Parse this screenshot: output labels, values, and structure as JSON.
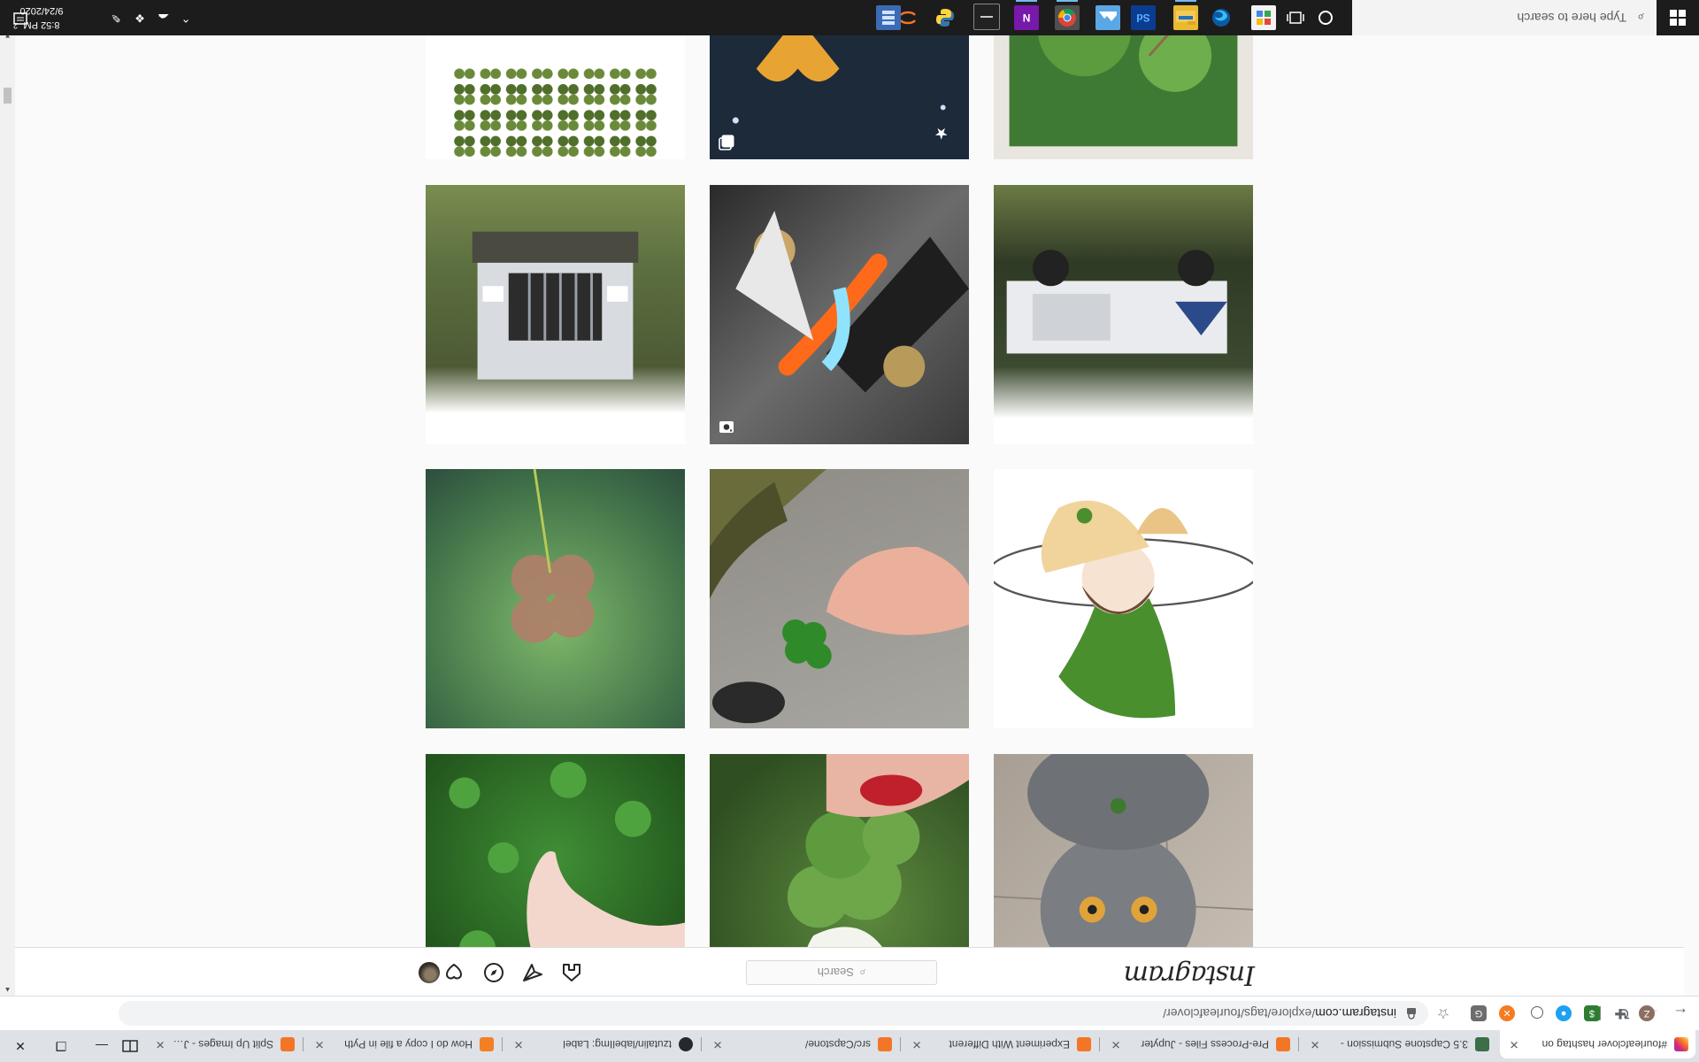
{
  "browser": {
    "tabs": [
      {
        "title": "#fourleafclover hashtag on",
        "favicon_color": "#d6249f",
        "active": true
      },
      {
        "title": "3.5 Capstone Submission - ",
        "favicon_color": "#3c6e47",
        "active": false
      },
      {
        "title": "Pre-Process Files - Jupyter",
        "favicon_color": "#f37626",
        "active": false
      },
      {
        "title": "Experiment With Different ",
        "favicon_color": "#f37626",
        "active": false
      },
      {
        "title": "src/Capstone/",
        "favicon_color": "#f37626",
        "active": false
      },
      {
        "title": "tzutalin/labelImg: Label",
        "favicon_color": "#24292e",
        "active": false
      },
      {
        "title": "How do I copy a file in Pyth",
        "favicon_color": "#f48024",
        "active": false
      },
      {
        "title": "Split Up Images - Jupyter N",
        "favicon_color": "#f37626",
        "active": false
      }
    ],
    "url_host": "instagram.com",
    "url_path": "/explore/tags/fourleafclover/",
    "profile_initial": "Z",
    "profile_color": "#8d6e63"
  },
  "instagram": {
    "logo": "Instagram",
    "search_placeholder": "Search"
  },
  "posts": [
    {
      "scene": "cat",
      "mark": "none"
    },
    {
      "scene": "clover-fingers",
      "mark": "none"
    },
    {
      "scene": "clover-hand",
      "mark": "none"
    },
    {
      "scene": "anime-girl",
      "mark": "carousel"
    },
    {
      "scene": "clover-sneaker",
      "mark": "none"
    },
    {
      "scene": "clover-water",
      "mark": "none"
    },
    {
      "scene": "truck-side",
      "mark": "carousel"
    },
    {
      "scene": "anime-fight",
      "mark": "video"
    },
    {
      "scene": "truck-front",
      "mark": "carousel"
    },
    {
      "scene": "garden",
      "mark": "none"
    },
    {
      "scene": "night-hearts",
      "mark": "carousel"
    },
    {
      "scene": "clover-pattern",
      "mark": "none"
    }
  ],
  "taskbar": {
    "search_placeholder": "Type here to search",
    "time": "8:52 PM",
    "date": "9/24/2020",
    "notification_count": "2",
    "apps": [
      "cortana-icon",
      "task-view-icon",
      "file-manager-icon",
      "edge-icon",
      "file-explorer-icon",
      "photoshop-express-icon",
      "mail-icon",
      "chrome-icon",
      "onenote-icon",
      "terminal-icon",
      "python-icon",
      "jupyter-icon",
      "database-icon"
    ]
  }
}
